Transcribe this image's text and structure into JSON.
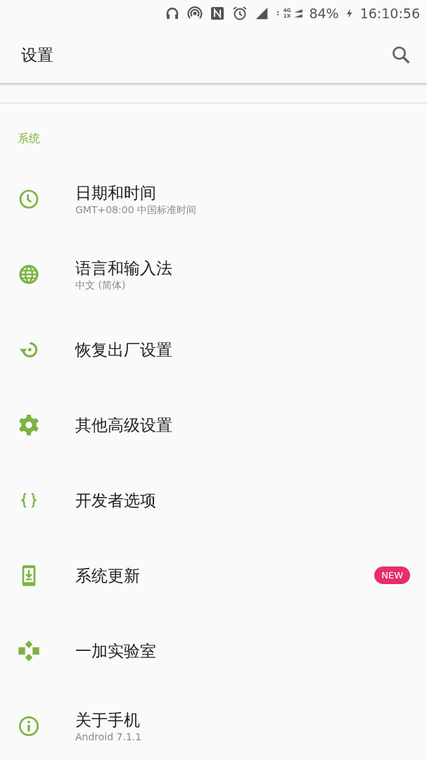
{
  "status_bar": {
    "network_labels": [
      "4G",
      "1X"
    ],
    "battery": "84%",
    "time": "16:10:56"
  },
  "app_bar": {
    "title": "设置"
  },
  "section": {
    "title": "系统"
  },
  "items": [
    {
      "title": "日期和时间",
      "subtitle": "GMT+08:00 中国标准时间"
    },
    {
      "title": "语言和输入法",
      "subtitle": "中文 (简体)"
    },
    {
      "title": "恢复出厂设置"
    },
    {
      "title": "其他高级设置"
    },
    {
      "title": "开发者选项"
    },
    {
      "title": "系统更新",
      "badge": "NEW"
    },
    {
      "title": "一加实验室"
    },
    {
      "title": "关于手机",
      "subtitle": "Android 7.1.1"
    }
  ]
}
